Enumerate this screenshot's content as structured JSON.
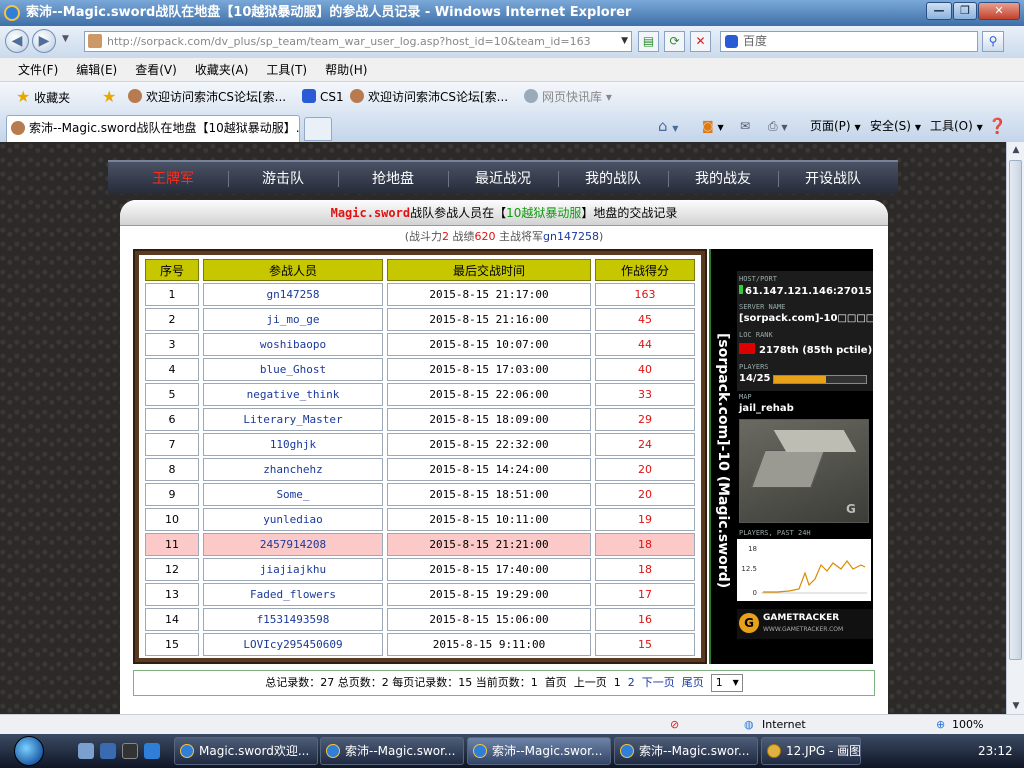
{
  "window": {
    "title": "索沛--Magic.sword战队在地盘【10越狱暴动服】的参战人员记录 - Windows Internet Explorer",
    "minimize": "—",
    "restore": "❐",
    "close": "✕"
  },
  "address": {
    "url": "http://sorpack.com/dv_plus/sp_team/team_war_user_log.asp?host_id=10&team_id=163",
    "search_value": "百度"
  },
  "menu": [
    "文件(F)",
    "编辑(E)",
    "查看(V)",
    "收藏夹(A)",
    "工具(T)",
    "帮助(H)"
  ],
  "favorites": {
    "label": "收藏夹",
    "items": [
      "欢迎访问索沛CS论坛[索...",
      "CS1",
      "欢迎访问索沛CS论坛[索...",
      "网页快讯库"
    ]
  },
  "tabs": {
    "active": "索沛--Magic.sword战队在地盘【10越狱暴动服】...",
    "commands": [
      "页面(P)",
      "安全(S)",
      "工具(O)"
    ]
  },
  "site_nav": [
    "王牌军",
    "游击队",
    "抢地盘",
    "最近战况",
    "我的战队",
    "我的战友",
    "开设战队"
  ],
  "panel": {
    "team": "Magic.sword",
    "text_mid": "战队参战人员在【",
    "server": "10越狱暴动服",
    "text_end": "】地盘的交战记录",
    "stats_open": "(战斗力",
    "power": "2",
    "stats_mid1": " 战绩",
    "record": "620",
    "stats_mid2": " 主战将军",
    "general": "gn147258",
    "stats_close": ")"
  },
  "table": {
    "headers": [
      "序号",
      "参战人员",
      "最后交战时间",
      "作战得分"
    ],
    "rows": [
      [
        "1",
        "gn147258",
        "2015-8-15 21:17:00",
        "163"
      ],
      [
        "2",
        "ji_mo_ge",
        "2015-8-15 21:16:00",
        "45"
      ],
      [
        "3",
        "woshibaopo",
        "2015-8-15 10:07:00",
        "44"
      ],
      [
        "4",
        "blue_Ghost",
        "2015-8-15 17:03:00",
        "40"
      ],
      [
        "5",
        "negative_think",
        "2015-8-15 22:06:00",
        "33"
      ],
      [
        "6",
        "Literary_Master",
        "2015-8-15 18:09:00",
        "29"
      ],
      [
        "7",
        "110ghjk",
        "2015-8-15 22:32:00",
        "24"
      ],
      [
        "8",
        "zhanchehz",
        "2015-8-15 14:24:00",
        "20"
      ],
      [
        "9",
        "Some_",
        "2015-8-15 18:51:00",
        "20"
      ],
      [
        "10",
        "yunlediao",
        "2015-8-15 10:11:00",
        "19"
      ],
      [
        "11",
        "2457914208",
        "2015-8-15 21:21:00",
        "18"
      ],
      [
        "12",
        "jiajiajkhu",
        "2015-8-15 17:40:00",
        "18"
      ],
      [
        "13",
        "Faded_flowers",
        "2015-8-15 19:29:00",
        "17"
      ],
      [
        "14",
        "f1531493598",
        "2015-8-15 15:06:00",
        "16"
      ],
      [
        "15",
        "LOVIcy295450609",
        "2015-8-15 9:11:00",
        "15"
      ]
    ],
    "highlight_row": 11
  },
  "gametracker": {
    "vertical": "[sorpack.com]-10 (Magic.sword)",
    "host_label": "HOST/PORT",
    "host": "61.147.121.146:27015",
    "name_label": "SERVER NAME",
    "name": "[sorpack.com]-10□□□□□",
    "rank_label": "LOC   RANK",
    "rank": "2178th (85th pctile)",
    "players_label": "PLAYERS",
    "players": "14/25",
    "players_fraction": 0.56,
    "map_label": "MAP",
    "map": "jail_rehab",
    "chart_label": "PLAYERS, PAST 24H",
    "chart_ticks": [
      "18",
      "12.5",
      "0"
    ],
    "brand": "GAMETRACKER",
    "brand_url": "WWW.GAMETRACKER.COM"
  },
  "pager": {
    "summary": "总记录数：27 总页数：2 每页记录数：15 当前页数：1",
    "first": "首页",
    "prev": "上一页",
    "page1": "1",
    "page2": "2",
    "next": "下一页",
    "last": "尾页",
    "select_value": "1"
  },
  "status": {
    "zone": "Internet",
    "zoom": "100%"
  },
  "taskbar": {
    "tasks": [
      "Magic.sword欢迎...",
      "索沛--Magic.swor...",
      "索沛--Magic.swor...",
      "索沛--Magic.swor...",
      "12.JPG - 画图"
    ],
    "clock": "23:12"
  },
  "colors": {
    "accent_red": "#e01212",
    "header_yellow": "#c7c700",
    "highlight_pink": "#fcc9c9"
  }
}
